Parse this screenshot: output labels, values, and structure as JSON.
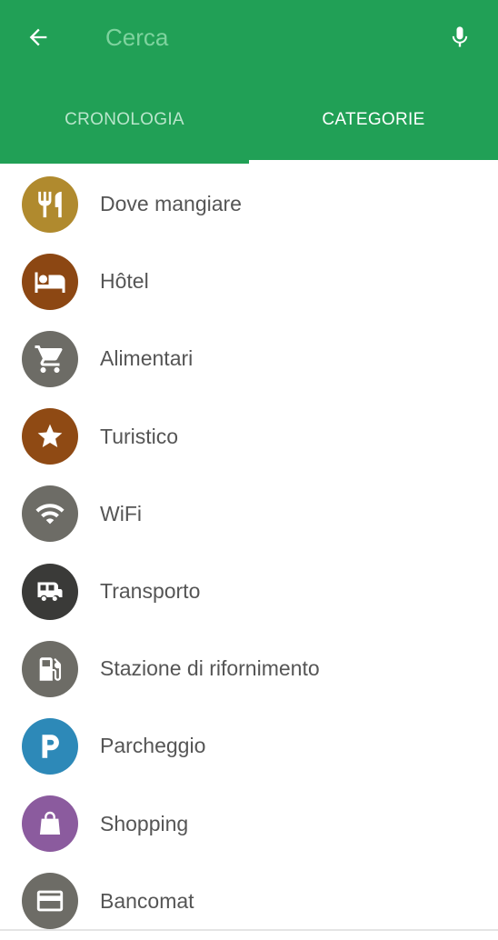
{
  "search": {
    "placeholder": "Cerca",
    "back_icon": "arrow-left-icon",
    "mic_icon": "microphone-icon"
  },
  "tabs": [
    {
      "label": "CRONOLOGIA",
      "active": false
    },
    {
      "label": "CATEGORIE",
      "active": true
    }
  ],
  "categories": [
    {
      "label": "Dove mangiare",
      "icon": "fork-knife-icon",
      "color": "#b08a2e"
    },
    {
      "label": "Hôtel",
      "icon": "bed-icon",
      "color": "#8c4713"
    },
    {
      "label": "Alimentari",
      "icon": "shopping-cart-icon",
      "color": "#6d6c66"
    },
    {
      "label": "Turistico",
      "icon": "star-icon",
      "color": "#8f4a14"
    },
    {
      "label": "WiFi",
      "icon": "wifi-icon",
      "color": "#6d6c66"
    },
    {
      "label": "Transporto",
      "icon": "bus-icon",
      "color": "#3a3a38"
    },
    {
      "label": "Stazione di rifornimento",
      "icon": "fuel-pump-icon",
      "color": "#6d6c66"
    },
    {
      "label": "Parcheggio",
      "icon": "parking-icon",
      "color": "#2d89b8"
    },
    {
      "label": "Shopping",
      "icon": "shopping-bag-icon",
      "color": "#8b5b9e"
    },
    {
      "label": "Bancomat",
      "icon": "credit-card-icon",
      "color": "#6d6c66"
    }
  ],
  "colors": {
    "header": "#21a056",
    "tab_inactive": "#b9e6cb",
    "tab_active": "#ffffff",
    "label_text": "#555555"
  }
}
